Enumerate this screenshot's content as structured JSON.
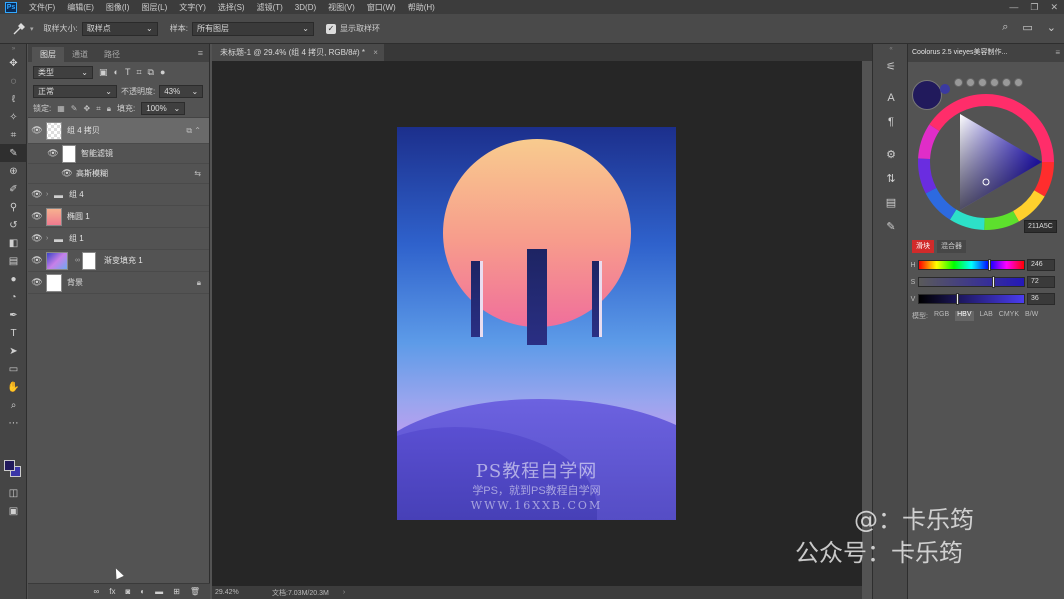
{
  "app": {
    "logo": "Ps"
  },
  "menu": [
    "文件(F)",
    "编辑(E)",
    "图像(I)",
    "图层(L)",
    "文字(Y)",
    "选择(S)",
    "滤镜(T)",
    "3D(D)",
    "视图(V)",
    "窗口(W)",
    "帮助(H)"
  ],
  "window_controls": {
    "minimize": "—",
    "restore": "❐",
    "close": "✕"
  },
  "options": {
    "tool_icon": "eyedropper-icon",
    "sample_size_label": "取样大小:",
    "sample_size_value": "取样点",
    "sample_label": "样本:",
    "sample_value": "所有图层",
    "show_ring_label": "显示取样环",
    "show_ring_checked": true
  },
  "layers_panel": {
    "tabs": [
      "图层",
      "通道",
      "路径"
    ],
    "filter_kind": "类型",
    "blend_mode": "正常",
    "opacity_label": "不透明度:",
    "opacity_value": "43%",
    "lock_label": "锁定:",
    "fill_label": "填充:",
    "fill_value": "100%",
    "layers": [
      {
        "name": "组 4 拷贝",
        "type": "smart",
        "selected": true
      },
      {
        "name": "智能滤镜",
        "type": "filter-mask"
      },
      {
        "name": "高斯模糊",
        "type": "filter"
      },
      {
        "name": "组 4",
        "type": "group"
      },
      {
        "name": "椭圆 1",
        "type": "shape"
      },
      {
        "name": "组 1",
        "type": "group"
      },
      {
        "name": "渐变填充 1",
        "type": "gradient"
      },
      {
        "name": "背景",
        "type": "background"
      }
    ]
  },
  "document": {
    "tab_title": "未标题-1 @ 29.4% (组 4 拷贝, RGB/8#) *",
    "close": "×",
    "watermark_title": "PS教程自学网",
    "watermark_sub": "学PS，就到PS教程自学网",
    "watermark_url": "WWW.16XXB.COM"
  },
  "status": {
    "zoom": "29.42%",
    "doc": "文档:7.03M/20.3M",
    "arrow": "›"
  },
  "color_panel": {
    "title": "Coolorus 2.5 vieyes美容制作...",
    "hex": "211A5C",
    "mode_tabs": [
      "滑块",
      "混合器"
    ],
    "sliders": [
      {
        "letter": "H",
        "value": "246",
        "fraction": 0.68
      },
      {
        "letter": "S",
        "value": "72",
        "fraction": 0.72
      },
      {
        "letter": "V",
        "value": "36",
        "fraction": 0.36
      }
    ],
    "models": [
      "模型:",
      "RGB",
      "HBV",
      "LAB",
      "CMYK",
      "B/W"
    ],
    "current_color": "#211a5c"
  },
  "overlay": {
    "line1": "@：卡乐筠",
    "line2": "公众号：卡乐筠"
  }
}
